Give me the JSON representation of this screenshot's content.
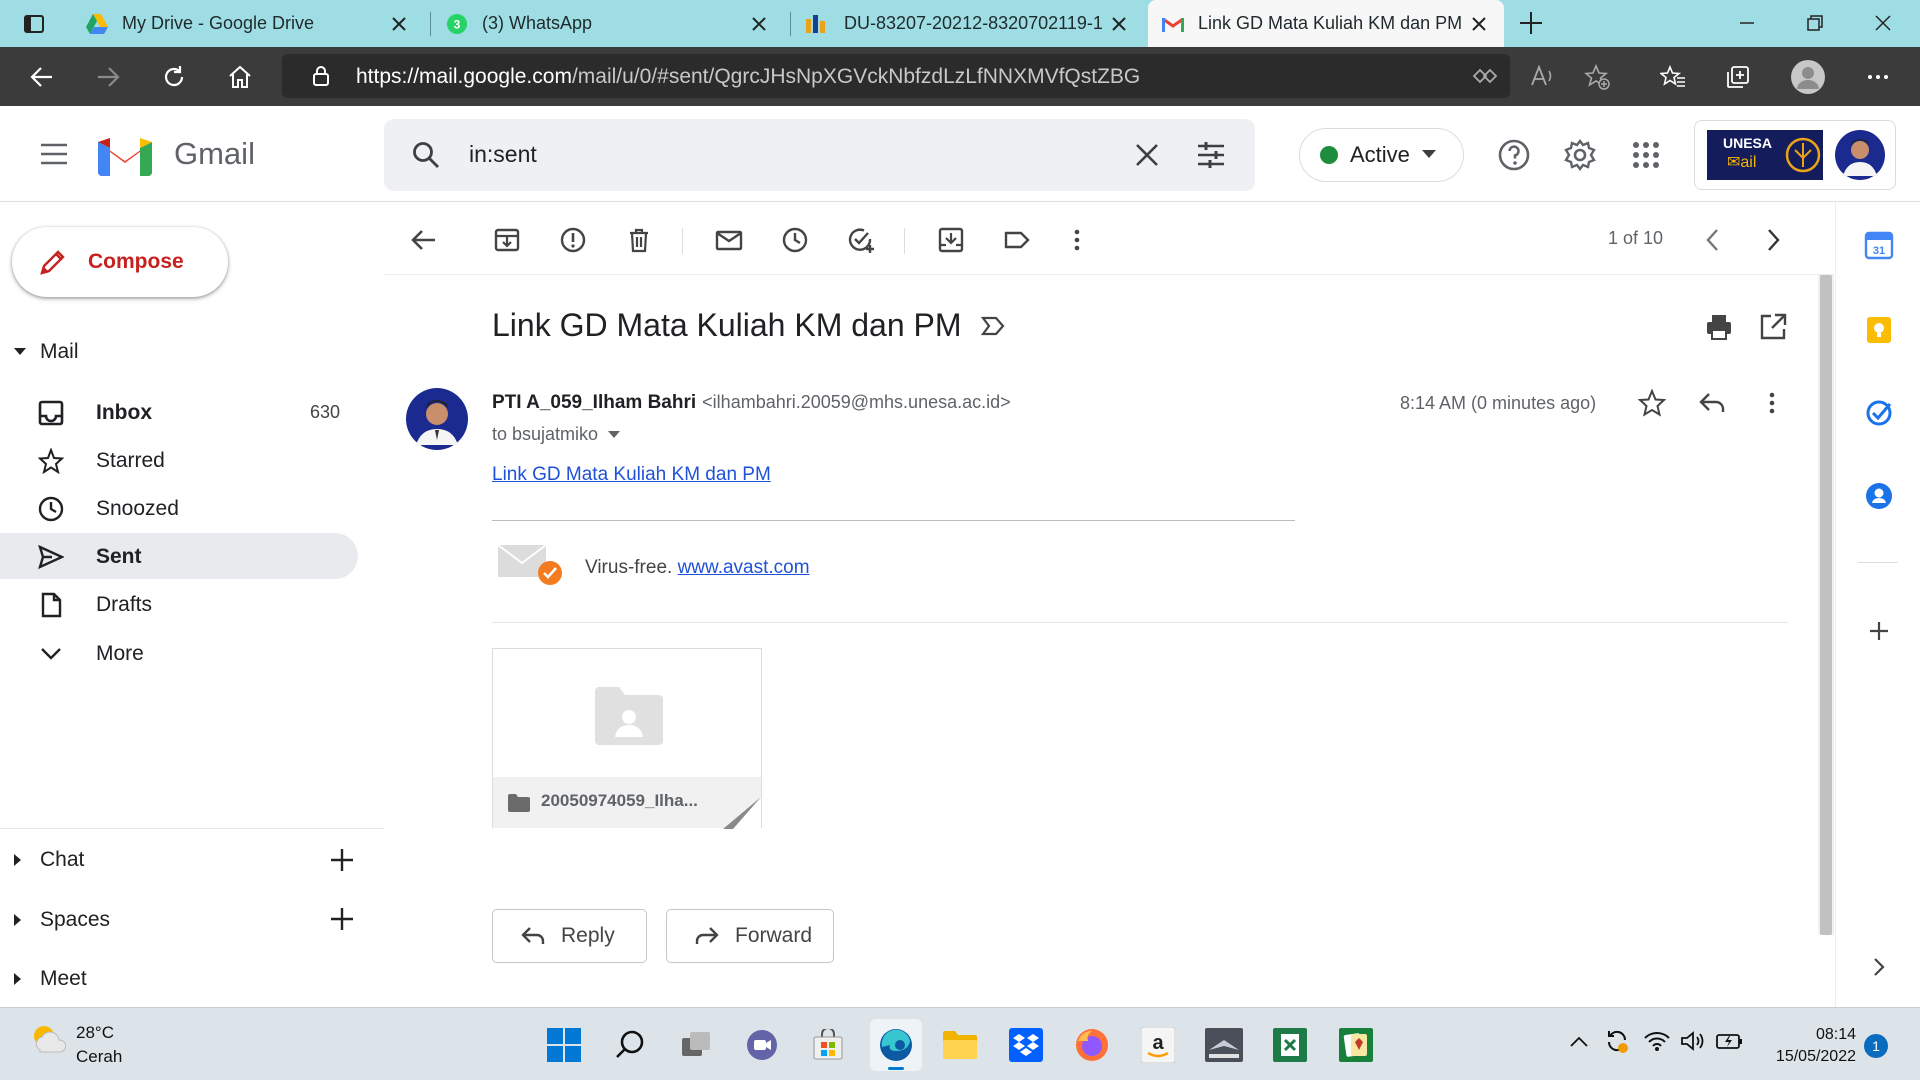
{
  "browser": {
    "tabs": [
      {
        "label": "My Drive - Google Drive",
        "icon": "google-drive-icon"
      },
      {
        "label": "(3) WhatsApp",
        "icon": "whatsapp-icon"
      },
      {
        "label": "DU-83207-20212-8320702119-1",
        "icon": "unesa-icon"
      },
      {
        "label": "Link GD Mata Kuliah KM dan PM",
        "icon": "gmail-icon",
        "active": true
      }
    ],
    "url_host": "https://mail.google.com",
    "url_path": "/mail/u/0/#sent/QgrcJHsNpXGVckNbfzdLzLfNNXMVfQstZBG"
  },
  "gmail": {
    "product": "Gmail",
    "search_query": "in:sent",
    "status": "Active",
    "brand_logo": "UNESA Mail",
    "compose_label": "Compose",
    "mail_section": "Mail",
    "nav": [
      {
        "label": "Inbox",
        "count": "630",
        "icon": "inbox-icon"
      },
      {
        "label": "Starred",
        "count": "",
        "icon": "star-icon"
      },
      {
        "label": "Snoozed",
        "count": "",
        "icon": "clock-icon"
      },
      {
        "label": "Sent",
        "count": "",
        "icon": "send-icon",
        "selected": true
      },
      {
        "label": "Drafts",
        "count": "",
        "icon": "draft-icon"
      },
      {
        "label": "More",
        "count": "",
        "icon": "chevron-down-icon"
      }
    ],
    "sections": [
      {
        "label": "Chat"
      },
      {
        "label": "Spaces"
      },
      {
        "label": "Meet"
      }
    ],
    "pager": "1 of 10"
  },
  "message": {
    "subject": "Link GD Mata Kuliah KM dan PM",
    "sender_name": "PTI A_059_Ilham Bahri",
    "sender_email": "<ilhambahri.20059@mhs.unesa.ac.id>",
    "recipient": "to bsujatmiko",
    "time": "8:14 AM (0 minutes ago)",
    "body_link": "Link GD Mata Kuliah KM dan PM",
    "virus_free_text": "Virus-free.",
    "virus_free_link": "www.avast.com",
    "attachment_name": "20050974059_Ilha...",
    "reply_label": "Reply",
    "forward_label": "Forward"
  },
  "taskbar": {
    "temperature": "28°C",
    "weather": "Cerah",
    "time": "08:14",
    "date": "15/05/2022",
    "notification_count": "1"
  },
  "colors": {
    "tabstrip": "#9fdde4",
    "addressbar": "#3b3b3b",
    "compose_text": "#c5221f",
    "active_dot": "#1e8e3e",
    "link": "#1f52d8"
  }
}
